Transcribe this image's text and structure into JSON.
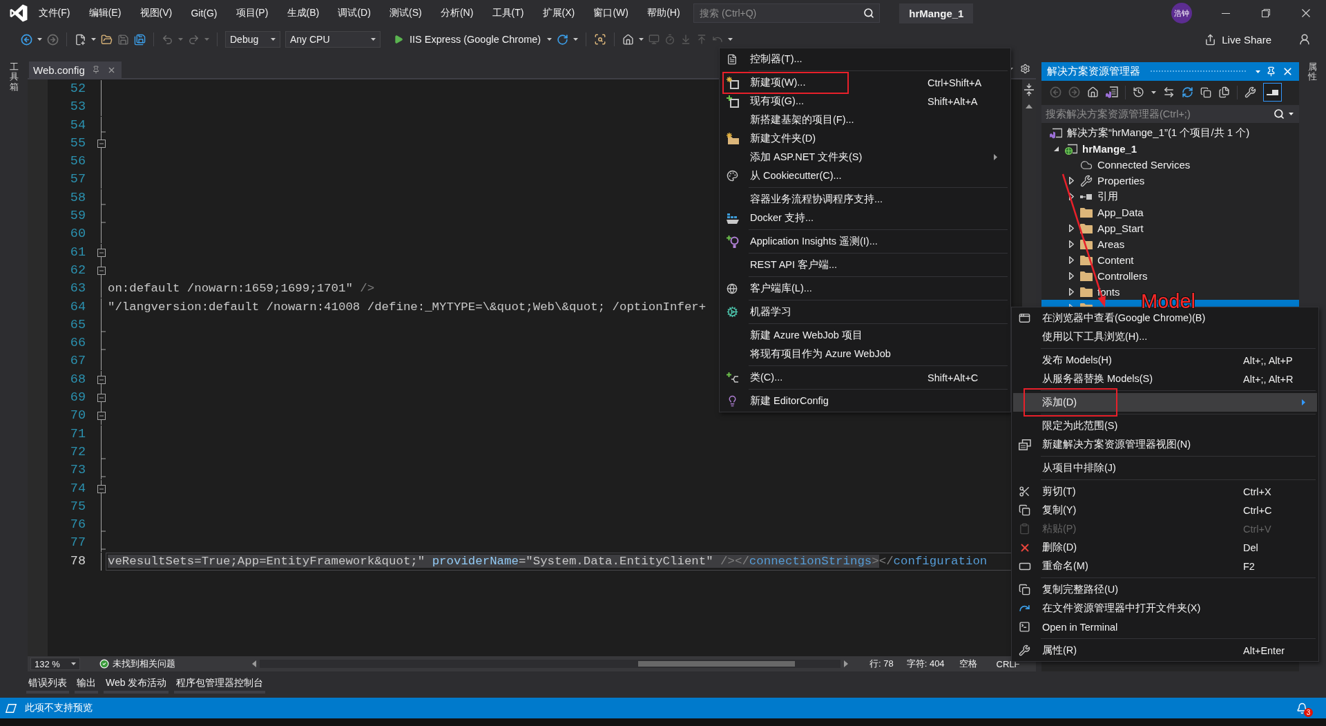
{
  "title_bar": {
    "menu": [
      "文件(F)",
      "编辑(E)",
      "视图(V)",
      "Git(G)",
      "项目(P)",
      "生成(B)",
      "调试(D)",
      "测试(S)",
      "分析(N)",
      "工具(T)",
      "扩展(X)",
      "窗口(W)",
      "帮助(H)"
    ],
    "search": {
      "placeholder": "搜索 (Ctrl+Q)"
    },
    "solution_name": "hrMange_1",
    "account_initials": "浩钟"
  },
  "toolbar": {
    "configuration": "Debug",
    "platform": "Any CPU",
    "run_target": "IIS Express (Google Chrome)",
    "live_share": "Live Share"
  },
  "toolbox_strip": {
    "label": "工具箱"
  },
  "document_tabs": [
    {
      "label": "Web.config",
      "selected": true
    }
  ],
  "editor": {
    "lines": [
      {
        "number": "52",
        "kind": "plain",
        "current": false
      },
      {
        "number": "53",
        "kind": "plain",
        "current": false
      },
      {
        "number": "54",
        "kind": "end",
        "current": false
      },
      {
        "number": "55",
        "kind": "start",
        "current": false
      },
      {
        "number": "56",
        "kind": "plain",
        "current": false
      },
      {
        "number": "57",
        "kind": "plain",
        "current": false
      },
      {
        "number": "58",
        "kind": "end",
        "current": false
      },
      {
        "number": "59",
        "kind": "end",
        "current": false
      },
      {
        "number": "60",
        "kind": "plain",
        "current": false
      },
      {
        "number": "61",
        "kind": "start",
        "current": false
      },
      {
        "number": "62",
        "kind": "start",
        "current": false
      },
      {
        "number": "63",
        "kind": "plain",
        "current": false,
        "tokens": [
          {
            "text": "on:default /nowarn:1659;1699;1701\"",
            "kind": "value",
            "selected": false
          },
          {
            "text": " />",
            "kind": "delimiter",
            "selected": false
          }
        ]
      },
      {
        "number": "64",
        "kind": "plain",
        "current": false,
        "tokens": [
          {
            "text": "\"/langversion:default /nowarn:41008 /define:_MYTYPE=\\&quot;Web\\&quot; /optionInfer+",
            "kind": "value",
            "selected": false
          }
        ]
      },
      {
        "number": "65",
        "kind": "end",
        "current": false
      },
      {
        "number": "66",
        "kind": "end",
        "current": false
      },
      {
        "number": "67",
        "kind": "plain",
        "current": false
      },
      {
        "number": "68",
        "kind": "start",
        "current": false
      },
      {
        "number": "69",
        "kind": "start",
        "current": false
      },
      {
        "number": "70",
        "kind": "start",
        "current": false
      },
      {
        "number": "71",
        "kind": "plain",
        "current": false
      },
      {
        "number": "72",
        "kind": "end",
        "current": false
      },
      {
        "number": "73",
        "kind": "end",
        "current": false
      },
      {
        "number": "74",
        "kind": "start",
        "current": false
      },
      {
        "number": "75",
        "kind": "plain",
        "current": false
      },
      {
        "number": "76",
        "kind": "end",
        "current": false
      },
      {
        "number": "77",
        "kind": "end",
        "current": false
      },
      {
        "number": "78",
        "kind": "plain",
        "current": true,
        "tokens": [
          {
            "text": "veResultSets=True;App=EntityFramework&quot;\"",
            "kind": "value",
            "selected": true
          },
          {
            "text": " providerName",
            "kind": "attribute",
            "selected": true
          },
          {
            "text": "=\"System.Data.EntityClient\"",
            "kind": "value",
            "selected": true
          },
          {
            "text": " /></",
            "kind": "delimiter",
            "selected": true
          },
          {
            "text": "connectionStrings",
            "kind": "tag",
            "selected": true
          },
          {
            "text": ">",
            "kind": "delimiter",
            "selected": true
          },
          {
            "text": "</",
            "kind": "delimiter",
            "selected": false
          },
          {
            "text": "configuration",
            "kind": "tag",
            "selected": false
          }
        ]
      }
    ]
  },
  "editor_status": {
    "zoom": "132 %",
    "issues": "未找到相关问题",
    "line": "行: 78",
    "column": "字符: 404",
    "whitespace": "空格",
    "line_ending": "CRLF"
  },
  "solution_explorer": {
    "title": "解决方案资源管理器",
    "toolbar": {
      "toggle": {
        "on": true
      }
    },
    "search": {
      "placeholder": "搜索解决方案资源管理器(Ctrl+;)"
    },
    "tree": [
      {
        "label": "解决方案“hrMange_1”(1 个项目/共 1 个)",
        "kind": "solution",
        "selected": false,
        "children": [
          {
            "label": "hrMange_1",
            "kind": "project",
            "expanded": true,
            "selected": false,
            "children": [
              {
                "label": "Connected Services",
                "kind": "service",
                "selected": false
              },
              {
                "label": "Properties",
                "kind": "properties",
                "expanded": false,
                "selected": false
              },
              {
                "label": "引用",
                "kind": "references",
                "expanded": false,
                "selected": false
              },
              {
                "label": "App_Data",
                "kind": "folder",
                "selected": false
              },
              {
                "label": "App_Start",
                "kind": "folder",
                "expanded": false,
                "selected": false
              },
              {
                "label": "Areas",
                "kind": "folder",
                "expanded": false,
                "selected": false
              },
              {
                "label": "Content",
                "kind": "folder",
                "expanded": false,
                "selected": false
              },
              {
                "label": "Controllers",
                "kind": "folder",
                "expanded": false,
                "selected": false
              },
              {
                "label": "fonts",
                "kind": "folder",
                "expanded": false,
                "selected": false
              },
              {
                "kind": "folder",
                "expanded": false,
                "selected": true
              }
            ]
          }
        ]
      }
    ]
  },
  "properties_strip": {
    "label": "属性"
  },
  "bottom_tabs": [
    "错误列表",
    "输出",
    "Web 发布活动",
    "程序包管理器控制台"
  ],
  "status_bar": {
    "message": "此项不支持预览",
    "notifications": "3"
  },
  "add_menu": {
    "groups": [
      {
        "items": [
          {
            "label": "控制器(T)...",
            "kind": "command"
          }
        ]
      },
      {
        "items": [
          {
            "label": "新建项(W)...",
            "shortcut": "Ctrl+Shift+A",
            "kind": "command"
          },
          {
            "label": "现有项(G)...",
            "shortcut": "Shift+Alt+A",
            "kind": "command"
          },
          {
            "label": "新搭建基架的项目(F)...",
            "kind": "command"
          },
          {
            "label": "新建文件夹(D)",
            "kind": "command"
          },
          {
            "label": "添加 ASP.NET 文件夹(S)",
            "kind": "submenu"
          },
          {
            "label": "从 Cookiecutter(C)...",
            "kind": "command"
          }
        ]
      },
      {
        "items": [
          {
            "label": "容器业务流程协调程序支持...",
            "kind": "command"
          },
          {
            "label": "Docker 支持...",
            "kind": "command"
          }
        ]
      },
      {
        "items": [
          {
            "label": "Application Insights 遥测(I)...",
            "kind": "command"
          }
        ]
      },
      {
        "items": [
          {
            "label": "REST API 客户端...",
            "kind": "command"
          }
        ]
      },
      {
        "items": [
          {
            "label": "客户端库(L)...",
            "kind": "command"
          }
        ]
      },
      {
        "items": [
          {
            "label": "机器学习",
            "kind": "command"
          }
        ]
      },
      {
        "items": [
          {
            "label": "新建 Azure WebJob 项目",
            "kind": "command"
          },
          {
            "label": "将现有项目作为 Azure WebJob",
            "kind": "command"
          }
        ]
      },
      {
        "items": [
          {
            "label": "类(C)...",
            "shortcut": "Shift+Alt+C",
            "kind": "command"
          }
        ]
      },
      {
        "items": [
          {
            "label": "新建 EditorConfig",
            "kind": "command"
          }
        ]
      }
    ]
  },
  "item_context_menu": {
    "groups": [
      {
        "items": [
          {
            "label": "在浏览器中查看(Google Chrome)(B)",
            "kind": "command",
            "selected": false,
            "disabled": false
          },
          {
            "label": "使用以下工具浏览(H)...",
            "kind": "command",
            "selected": false,
            "disabled": false
          }
        ]
      },
      {
        "items": [
          {
            "label": "发布 Models(H)",
            "shortcut": "Alt+;, Alt+P",
            "kind": "command",
            "selected": false,
            "disabled": false
          },
          {
            "label": "从服务器替换 Models(S)",
            "shortcut": "Alt+;, Alt+R",
            "kind": "command",
            "selected": false,
            "disabled": false
          }
        ]
      },
      {
        "items": [
          {
            "label": "添加(D)",
            "kind": "submenu",
            "selected": true,
            "disabled": false
          }
        ]
      },
      {
        "items": [
          {
            "label": "限定为此范围(S)",
            "kind": "command",
            "selected": false,
            "disabled": false
          },
          {
            "label": "新建解决方案资源管理器视图(N)",
            "kind": "command",
            "selected": false,
            "disabled": false
          }
        ]
      },
      {
        "items": [
          {
            "label": "从项目中排除(J)",
            "kind": "command",
            "selected": false,
            "disabled": false
          }
        ]
      },
      {
        "items": [
          {
            "label": "剪切(T)",
            "shortcut": "Ctrl+X",
            "kind": "command",
            "selected": false,
            "disabled": false
          },
          {
            "label": "复制(Y)",
            "shortcut": "Ctrl+C",
            "kind": "command",
            "selected": false,
            "disabled": false
          },
          {
            "label": "粘贴(P)",
            "shortcut": "Ctrl+V",
            "kind": "command",
            "selected": false,
            "disabled": true
          },
          {
            "label": "删除(D)",
            "shortcut": "Del",
            "kind": "command",
            "selected": false,
            "disabled": false
          },
          {
            "label": "重命名(M)",
            "shortcut": "F2",
            "kind": "command",
            "selected": false,
            "disabled": false
          }
        ]
      },
      {
        "items": [
          {
            "label": "复制完整路径(U)",
            "kind": "command",
            "selected": false,
            "disabled": false
          },
          {
            "label": "在文件资源管理器中打开文件夹(X)",
            "kind": "command",
            "selected": false,
            "disabled": false
          },
          {
            "label": "Open in Terminal",
            "kind": "command",
            "selected": false,
            "disabled": false
          }
        ]
      },
      {
        "items": [
          {
            "label": "属性(R)",
            "shortcut": "Alt+Enter",
            "kind": "command",
            "selected": false,
            "disabled": false
          }
        ]
      }
    ]
  },
  "annotation": {
    "label": "Model"
  }
}
